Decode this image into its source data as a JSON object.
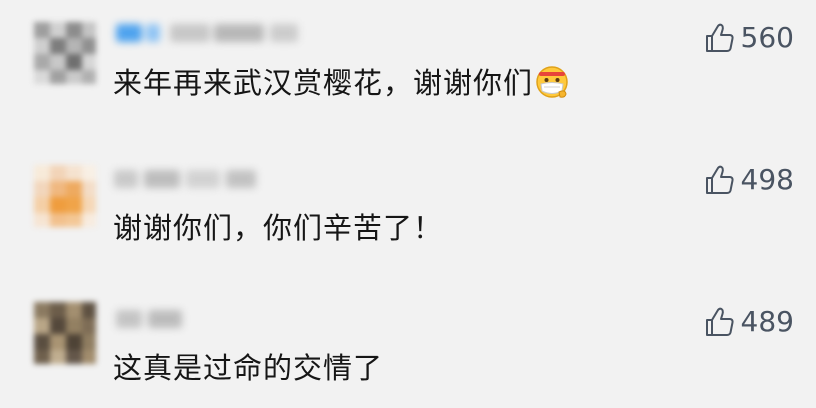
{
  "comments": [
    {
      "text": "来年再来武汉赏樱花，谢谢你们",
      "emoji": "face-with-medical-mask-emoji",
      "likes": "560"
    },
    {
      "text": "谢谢你们，你们辛苦了！",
      "likes": "498"
    },
    {
      "text": "这真是过命的交情了",
      "likes": "489"
    }
  ],
  "icons": {
    "like": "thumbs-up-icon"
  },
  "colors": {
    "background": "#f2f2f2",
    "text": "#161616",
    "like": "#4a5462"
  }
}
